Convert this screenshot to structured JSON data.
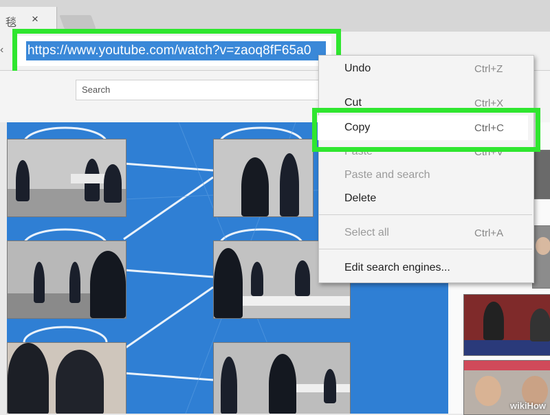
{
  "tab": {
    "title": "毯",
    "close": "×"
  },
  "address_bar": {
    "url": "https://www.youtube.com/watch?v=zaoq8fF65a0"
  },
  "page": {
    "search_placeholder": "Search"
  },
  "context_menu": {
    "items": [
      {
        "label": "Undo",
        "shortcut": "Ctrl+Z",
        "enabled": true
      },
      {
        "label": "Cut",
        "shortcut": "Ctrl+X",
        "enabled": true
      },
      {
        "label": "Copy",
        "shortcut": "Ctrl+C",
        "enabled": true,
        "highlighted": true
      },
      {
        "label": "Paste",
        "shortcut": "Ctrl+V",
        "enabled": false
      },
      {
        "label": "Paste and search",
        "shortcut": "",
        "enabled": false
      },
      {
        "label": "Delete",
        "shortcut": "",
        "enabled": true
      },
      {
        "label": "Select all",
        "shortcut": "Ctrl+A",
        "enabled": false
      },
      {
        "label": "Edit search engines...",
        "shortcut": "",
        "enabled": true
      }
    ]
  },
  "watermark": "wikiHow",
  "colors": {
    "highlight_green": "#2fe62f",
    "selection_blue": "#3a88d8",
    "canvas_blue": "#2f7fd4"
  }
}
